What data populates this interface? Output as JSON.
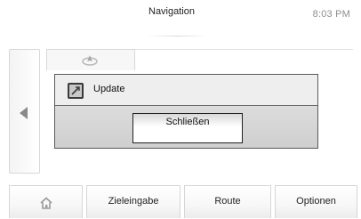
{
  "header": {
    "title": "Navigation",
    "clock": "8:03 PM"
  },
  "dialog": {
    "title": "Update",
    "icon": "update-icon",
    "close_label": "Schließen"
  },
  "bottom_bar": {
    "home_icon": "home-icon",
    "items": [
      {
        "label": "Zieleingabe"
      },
      {
        "label": "Route"
      },
      {
        "label": "Optionen"
      }
    ]
  },
  "colors": {
    "dialog_border": "#5a5a5a",
    "clock_text": "#8e8e8e",
    "panel_border": "#d8d8d8"
  }
}
